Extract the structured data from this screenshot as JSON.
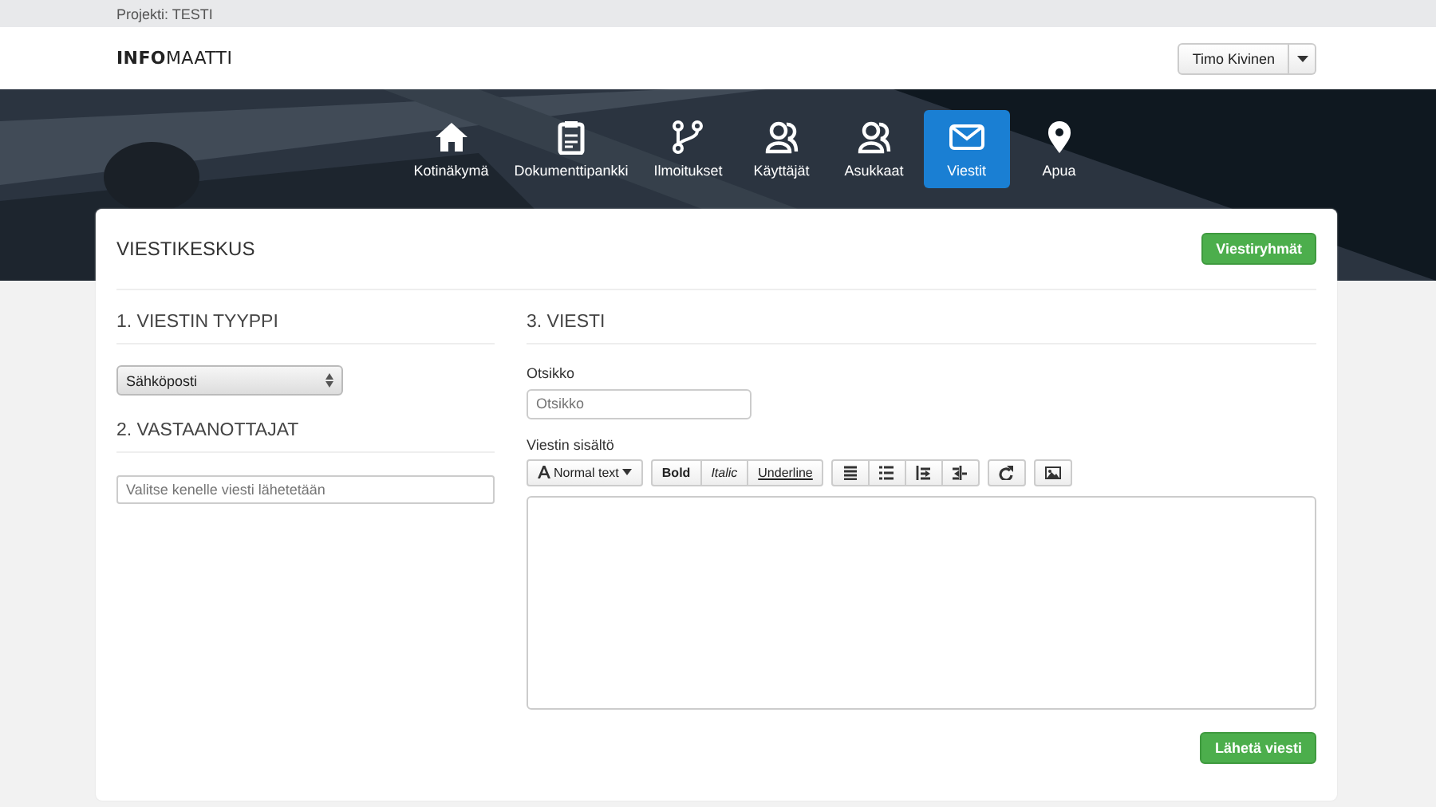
{
  "project_bar": {
    "label": "Projekti: TESTI"
  },
  "header": {
    "logo_bold": "INFO",
    "logo_light": "MAATTI",
    "user_button": "Timo Kivinen"
  },
  "nav": [
    {
      "label": "Kotinäkymä",
      "selected": false
    },
    {
      "label": "Dokumenttipankki",
      "selected": false
    },
    {
      "label": "Ilmoitukset",
      "selected": false
    },
    {
      "label": "Käyttäjät",
      "selected": false
    },
    {
      "label": "Asukkaat",
      "selected": false
    },
    {
      "label": "Viestit",
      "selected": true
    },
    {
      "label": "Apua",
      "selected": false
    }
  ],
  "page": {
    "title": "VIESTIKESKUS",
    "groups_button": "Viestiryhmät"
  },
  "type_section": {
    "heading": "1. VIESTIN TYYPPI",
    "select_value": "Sähköposti"
  },
  "recipients_section": {
    "heading": "2. VASTAANOTTAJAT",
    "placeholder": "Valitse kenelle viesti lähetetään"
  },
  "message_section": {
    "heading": "3. VIESTI",
    "subject_label": "Otsikko",
    "subject_placeholder": "Otsikko",
    "body_label": "Viestin sisältö",
    "toolbar": [
      [
        {
          "kind": "format",
          "label": "Normal text"
        }
      ],
      [
        {
          "kind": "bold",
          "label": "Bold"
        },
        {
          "kind": "italic",
          "label": "Italic"
        },
        {
          "kind": "underline",
          "label": "Underline"
        }
      ],
      [
        {
          "kind": "icon"
        },
        {
          "kind": "icon"
        },
        {
          "kind": "icon"
        },
        {
          "kind": "icon"
        }
      ],
      [
        {
          "kind": "icon"
        }
      ],
      [
        {
          "kind": "icon"
        }
      ]
    ],
    "send_button": "Lähetä viesti"
  }
}
